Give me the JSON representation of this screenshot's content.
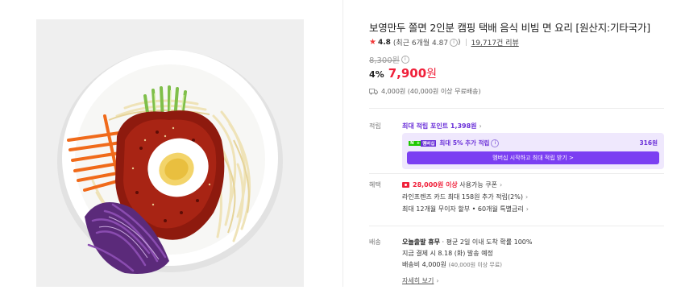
{
  "product": {
    "title": "보영만두 쫄면 2인분 캠핑 택배 음식 비빔 면 요리 [원산지:기타국가]",
    "rating": "4.8",
    "rating_recent": "(최근 6개월 4.87",
    "rating_recent_close": ")",
    "review_count": "19,717건 리뷰",
    "original_price": "8,300원",
    "discount": "4%",
    "price": "7,900",
    "price_unit": "원",
    "shipping": "4,000원 (40,000원 이상 무료배송)"
  },
  "points": {
    "label": "적립",
    "max_point": "최대 적립 포인트 1,398원",
    "badge_n": "N",
    "badge_plus": "+",
    "badge_m": "멤버십",
    "extra": "최대 5% 추가 적립",
    "extra_amount": "316원",
    "membership_button": "멤버십 시작하고 최대 적립 받기 >"
  },
  "benefits": {
    "label": "혜택",
    "coupon_amount": "28,000원 이상",
    "coupon_text": "사용가능 쿠폰",
    "card": "라인프렌즈 카드 최대 158원 추가 적립(2%)",
    "installment": "최대 12개월 무이자 할부 • 60개월 특별금리"
  },
  "delivery": {
    "label": "배송",
    "status": "오늘출발 휴무",
    "status_note": "· 평균 2일 이내 도착 확률 100%",
    "eta": "지금 결제 시 8.18 (화) 발송 예정",
    "fee": "배송비 4,000원",
    "fee_note": "(40,000원 이상 무료)",
    "more": "자세히 보기"
  },
  "icons": {
    "star": "star-icon",
    "info": "info-icon",
    "truck": "truck-icon",
    "chevron": "chevron-right-icon",
    "coupon": "coupon-icon"
  },
  "colors": {
    "price_red": "#f0203a",
    "naver_purple": "#7b3ff2",
    "naver_green": "#1ec800"
  }
}
